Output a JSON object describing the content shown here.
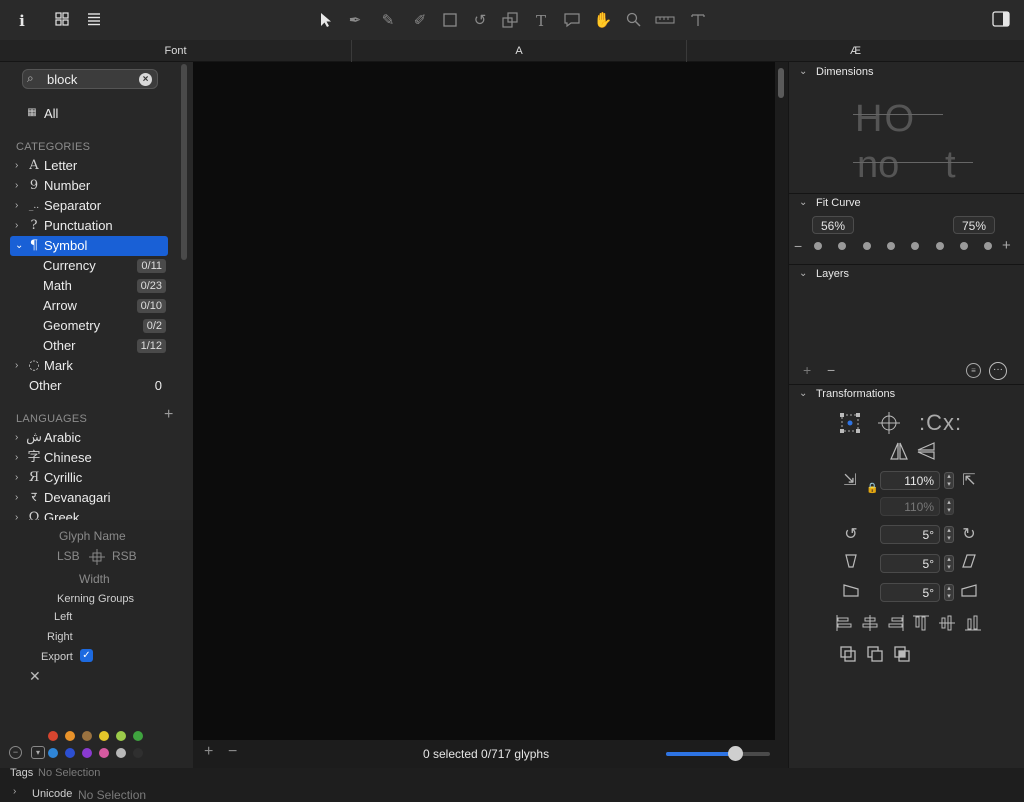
{
  "toolbar": {
    "left_icons": [
      "info-icon",
      "grid-view-icon",
      "list-view-icon"
    ],
    "tools": [
      "select-tool",
      "pen-tool",
      "draw-tool",
      "brush-tool",
      "shape-tool",
      "rotate-tool",
      "scale-tool",
      "text-tool",
      "annotation-tool",
      "hand-tool",
      "zoom-tool",
      "measure-tool",
      "type-tool"
    ],
    "right_icons": [
      "sidebar-toggle-icon"
    ]
  },
  "tabs": [
    {
      "label": "Font"
    },
    {
      "label": "A"
    },
    {
      "label": "Æ"
    }
  ],
  "sidebar": {
    "search": {
      "value": "block",
      "placeholder": ""
    },
    "all_label": "All",
    "categories_header": "CATEGORIES",
    "categories": [
      {
        "glyph": "A",
        "label": "Letter"
      },
      {
        "glyph": "9",
        "label": "Number"
      },
      {
        "glyph": "_..",
        "label": "Separator"
      },
      {
        "glyph": "?",
        "label": "Punctuation"
      },
      {
        "glyph": "¶",
        "label": "Symbol"
      }
    ],
    "symbol_sub": [
      {
        "label": "Currency",
        "count": "0/11"
      },
      {
        "label": "Math",
        "count": "0/23"
      },
      {
        "label": "Arrow",
        "count": "0/10"
      },
      {
        "label": "Geometry",
        "count": "0/2"
      },
      {
        "label": "Other",
        "count": "1/12"
      }
    ],
    "mark": {
      "glyph": "◌",
      "label": "Mark"
    },
    "other": {
      "label": "Other",
      "count": "0"
    },
    "languages_header": "LANGUAGES",
    "languages": [
      {
        "glyph": "ش",
        "label": "Arabic"
      },
      {
        "glyph": "字",
        "label": "Chinese"
      },
      {
        "glyph": "Я",
        "label": "Cyrillic"
      },
      {
        "glyph": "र",
        "label": "Devanagari"
      },
      {
        "glyph": "Ω",
        "label": "Greek"
      }
    ],
    "info": {
      "glyph_name": "Glyph Name",
      "lsb": "LSB",
      "rsb": "RSB",
      "width": "Width",
      "kerning_groups": "Kerning Groups",
      "left": "Left",
      "right": "Right",
      "export": "Export",
      "tags_label": "Tags",
      "tags_value": "No Selection",
      "unicode_label": "Unicode",
      "unicode_value": "No Selection"
    },
    "colors_row1": [
      "#d6452f",
      "#e8922a",
      "#9a7240",
      "#e3c52a",
      "#9ccb4a",
      "#3fa33f"
    ],
    "colors_row2": [
      "#2f86d8",
      "#2c4fd1",
      "#8a3ad0",
      "#d65aa0",
      "#b8b8b8",
      "#2f2f2f"
    ]
  },
  "bottom": {
    "status": "0 selected 0/717 glyphs",
    "zoom_fraction": 0.66
  },
  "panel": {
    "dimensions": {
      "title": "Dimensions",
      "sample1": "HO",
      "sample2": "no",
      "sample3": "t"
    },
    "fit_curve": {
      "title": "Fit Curve",
      "left_value": "56%",
      "right_value": "75%",
      "dots": 8
    },
    "layers": {
      "title": "Layers"
    },
    "transformations": {
      "title": "Transformations",
      "scale_value": "110%",
      "scale_value2": "110%",
      "rotate_value": "5°",
      "slant_value": "5°",
      "skew_value": "5°"
    }
  }
}
